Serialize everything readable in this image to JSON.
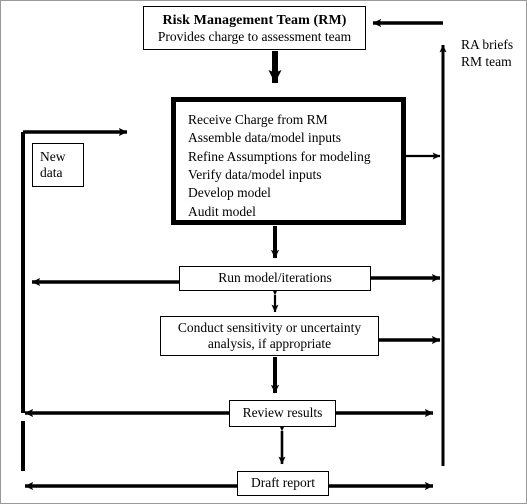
{
  "diagram": {
    "title": "Risk assessment modeling process flowchart",
    "background_color": "#ffffff",
    "line_color": "#000000",
    "border_color": "#9a9a9a"
  },
  "nodes": {
    "risk_management_team": {
      "title": "Risk Management Team (RM)",
      "subtitle": "Provides charge to assessment team"
    },
    "main_process": {
      "steps": [
        "Receive Charge from RM",
        "Assemble data/model inputs",
        "Refine Assumptions for modeling",
        "Verify data/model inputs",
        "Develop model",
        "Audit model"
      ]
    },
    "new_data": {
      "line1": "New",
      "line2": "data"
    },
    "run_model": {
      "label": "Run model/iterations"
    },
    "sensitivity": {
      "line1": "Conduct sensitivity or uncertainty",
      "line2": "analysis, if appropriate"
    },
    "review_results": {
      "label": "Review results"
    },
    "draft_report": {
      "label": "Draft report"
    }
  },
  "labels": {
    "ra_briefs": {
      "line1": "RA briefs",
      "line2": "RM team"
    }
  },
  "connectors": [
    {
      "name": "rm-to-main",
      "type": "arrow-down",
      "style": "thick"
    },
    {
      "name": "main-to-run",
      "type": "arrow-down",
      "style": "medium"
    },
    {
      "name": "run-to-sensitivity",
      "type": "arrow-double-vertical",
      "style": "thin"
    },
    {
      "name": "sensitivity-to-review",
      "type": "arrow-down",
      "style": "medium"
    },
    {
      "name": "review-to-draft",
      "type": "arrow-double-vertical",
      "style": "thin"
    },
    {
      "name": "main-to-right-bus",
      "type": "arrow-right",
      "style": "thin"
    },
    {
      "name": "run-to-right-bus",
      "type": "arrow-right",
      "style": "thick"
    },
    {
      "name": "sensitivity-to-right-bus",
      "type": "arrow-right",
      "style": "thick"
    },
    {
      "name": "review-to-right-bus",
      "type": "arrow-right",
      "style": "thick"
    },
    {
      "name": "draft-to-right",
      "type": "arrow-right",
      "style": "thick"
    },
    {
      "name": "right-bus-up-to-rm",
      "type": "arrow-up",
      "style": "thin"
    },
    {
      "name": "right-bus-into-rm",
      "type": "arrow-left",
      "style": "thick"
    },
    {
      "name": "run-to-left-bus",
      "type": "arrow-left",
      "style": "thick"
    },
    {
      "name": "review-to-left-bus",
      "type": "arrow-left",
      "style": "thick"
    },
    {
      "name": "draft-to-left-bus",
      "type": "arrow-left",
      "style": "thick"
    },
    {
      "name": "left-bus-to-main",
      "type": "arrow-right",
      "style": "thick"
    }
  ]
}
